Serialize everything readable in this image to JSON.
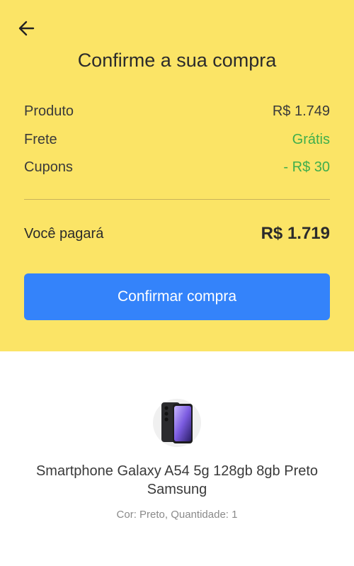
{
  "header": {
    "back_icon": "arrow-left-icon",
    "title": "Confirme a sua compra"
  },
  "summary": {
    "rows": [
      {
        "label": "Produto",
        "value": "R$ 1.749",
        "color": "#333333"
      },
      {
        "label": "Frete",
        "value": "Grátis",
        "color": "#3fae4c"
      },
      {
        "label": "Cupons",
        "value": "- R$ 30",
        "color": "#3fae4c"
      }
    ],
    "total_label": "Você pagará",
    "total_value": "R$ 1.719"
  },
  "actions": {
    "confirm_label": "Confirmar compra",
    "button_color": "#3483fa"
  },
  "product": {
    "image_icon": "smartphone-image",
    "name": "Smartphone Galaxy A54 5g 128gb 8gb Preto Samsung",
    "meta": "Cor: Preto, Quantidade: 1"
  },
  "colors": {
    "header_bg": "#fbe466",
    "accent_green": "#3fae4c"
  }
}
